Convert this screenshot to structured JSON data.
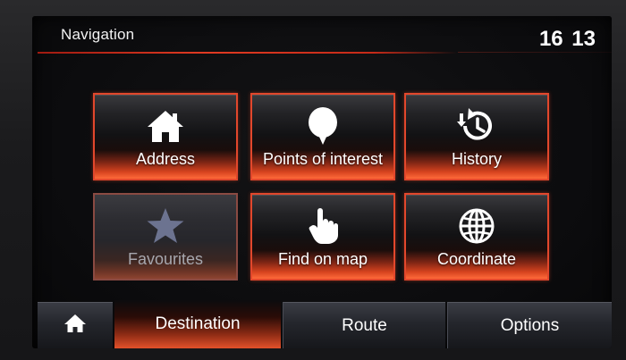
{
  "header": {
    "title": "Navigation",
    "clock": "16 13"
  },
  "tiles": [
    {
      "label": "Address",
      "icon": "home-icon",
      "enabled": true
    },
    {
      "label": "Points of interest",
      "icon": "location-pin-icon",
      "enabled": true
    },
    {
      "label": "History",
      "icon": "history-clock-icon",
      "enabled": true
    },
    {
      "label": "Favourites",
      "icon": "star-icon",
      "enabled": false
    },
    {
      "label": "Find on map",
      "icon": "hand-pointer-icon",
      "enabled": true
    },
    {
      "label": "Coordinate",
      "icon": "globe-icon",
      "enabled": true
    }
  ],
  "tabs": {
    "home_icon": "home-icon",
    "items": [
      {
        "label": "Destination",
        "active": true
      },
      {
        "label": "Route",
        "active": false
      },
      {
        "label": "Options",
        "active": false
      }
    ]
  },
  "colors": {
    "accent": "#e2472c",
    "tile_text": "#ffffff",
    "disabled_text": "#a7a7ae"
  }
}
